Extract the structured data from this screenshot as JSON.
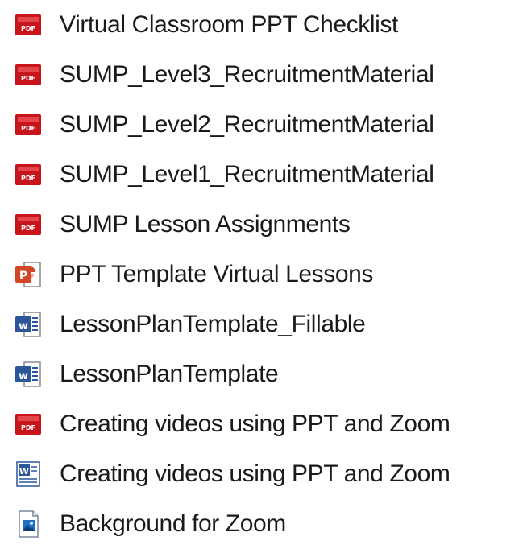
{
  "file_list": {
    "items": [
      {
        "name": "Virtual Classroom PPT Checklist",
        "icon": "pdf-icon",
        "type": "pdf"
      },
      {
        "name": "SUMP_Level3_RecruitmentMaterial",
        "icon": "pdf-icon",
        "type": "pdf"
      },
      {
        "name": "SUMP_Level2_RecruitmentMaterial",
        "icon": "pdf-icon",
        "type": "pdf"
      },
      {
        "name": "SUMP_Level1_RecruitmentMaterial",
        "icon": "pdf-icon",
        "type": "pdf"
      },
      {
        "name": "SUMP Lesson Assignments",
        "icon": "pdf-icon",
        "type": "pdf"
      },
      {
        "name": "PPT Template Virtual Lessons",
        "icon": "powerpoint-icon",
        "type": "pptx"
      },
      {
        "name": "LessonPlanTemplate_Fillable",
        "icon": "word-docx-icon",
        "type": "docx"
      },
      {
        "name": "LessonPlanTemplate",
        "icon": "word-docx-icon",
        "type": "docx"
      },
      {
        "name": "Creating videos using PPT and Zoom",
        "icon": "pdf-icon",
        "type": "pdf"
      },
      {
        "name": "Creating videos using PPT and Zoom",
        "icon": "word-doc-icon",
        "type": "doc"
      },
      {
        "name": "Background for Zoom",
        "icon": "image-icon",
        "type": "image"
      }
    ]
  },
  "colors": {
    "pdf_red": "#c8141b",
    "ppt_orange": "#d24625",
    "word_blue": "#2b579a",
    "text": "#1a1a1a"
  }
}
